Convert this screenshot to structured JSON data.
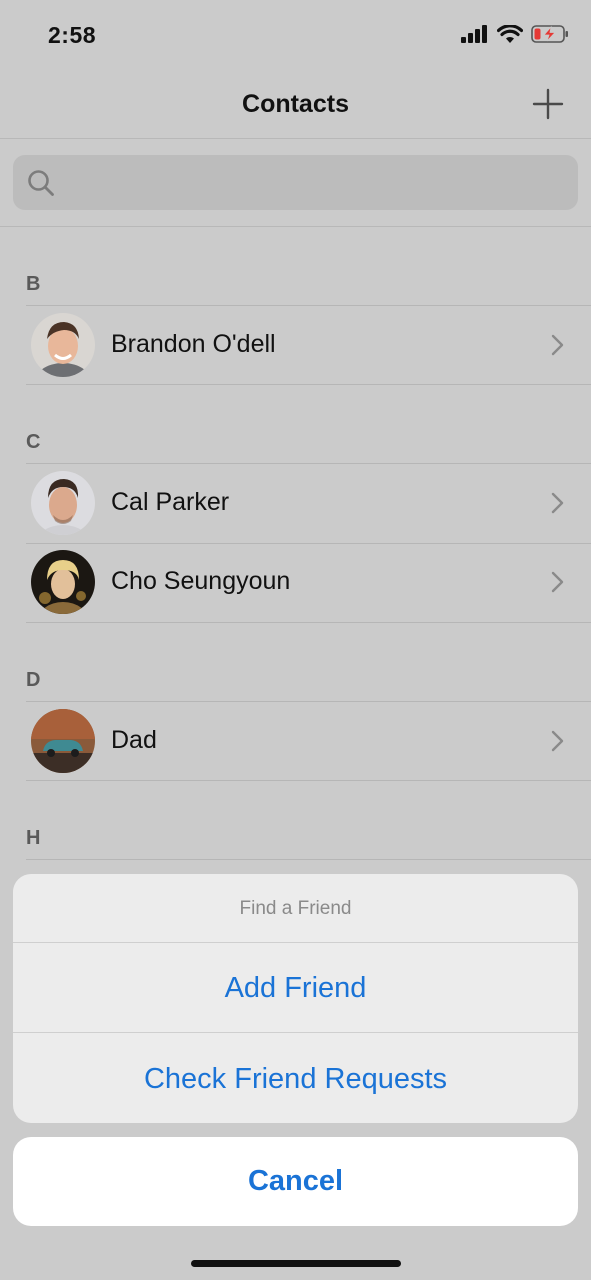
{
  "status_bar": {
    "time": "2:58"
  },
  "nav": {
    "title": "Contacts"
  },
  "search": {
    "placeholder": ""
  },
  "sections": [
    {
      "letter": "B",
      "contacts": [
        {
          "name": "Brandon O'dell"
        }
      ]
    },
    {
      "letter": "C",
      "contacts": [
        {
          "name": "Cal Parker"
        },
        {
          "name": "Cho Seungyoun"
        }
      ]
    },
    {
      "letter": "D",
      "contacts": [
        {
          "name": "Dad"
        }
      ]
    },
    {
      "letter": "H",
      "contacts": []
    }
  ],
  "action_sheet": {
    "title": "Find a Friend",
    "actions": [
      "Add Friend",
      "Check Friend Requests"
    ],
    "cancel": "Cancel"
  },
  "colors": {
    "accent": "#1a73d6",
    "background": "#cbcbcb",
    "battery_low": "#e53935"
  }
}
